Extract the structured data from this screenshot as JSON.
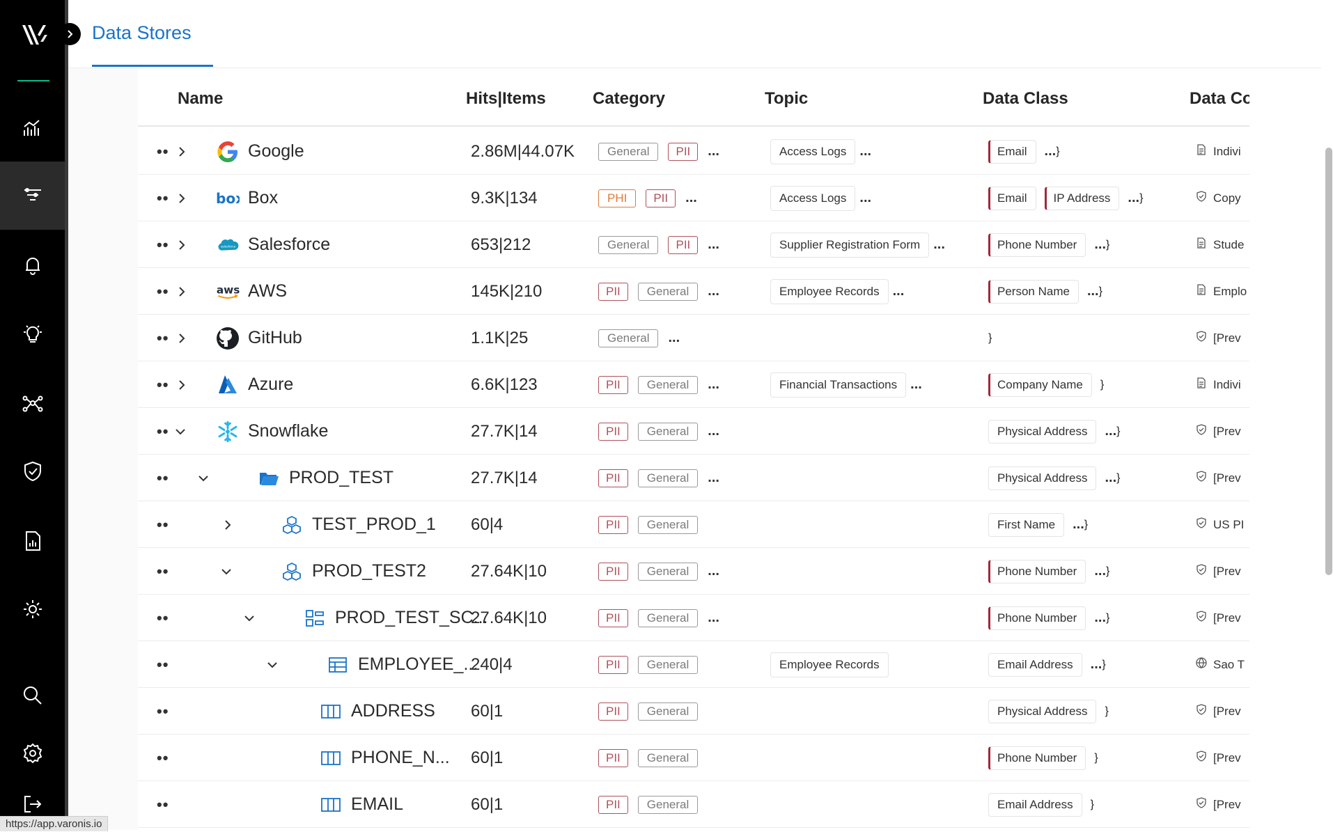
{
  "header": {
    "tab_label": "Data Stores"
  },
  "status_url": "https://app.varonis.io",
  "columns": {
    "name": "Name",
    "hits": "Hits|Items",
    "category": "Category",
    "topic": "Topic",
    "data_class": "Data Class",
    "data_co": "Data Co"
  },
  "rows": [
    {
      "name": "Google",
      "hits": "2.86M|44.07K",
      "tags": [
        "General",
        "PII"
      ],
      "more": "...",
      "topics": [
        "Access Logs"
      ],
      "topic_more": "...",
      "classes": [
        "Email"
      ],
      "class_more": "...",
      "dco": "Indivi",
      "icon": "google-logo",
      "dco_icon": "document-icon"
    },
    {
      "name": "Box",
      "hits": "9.3K|134",
      "tags": [
        "PHI",
        "PII"
      ],
      "more": "...",
      "topics": [
        "Access Logs"
      ],
      "topic_more": "...",
      "classes": [
        "Email",
        "IP Address"
      ],
      "class_more": "...",
      "dco": "Copy",
      "icon": "box-logo",
      "dco_icon": "shield-icon"
    },
    {
      "name": "Salesforce",
      "hits": "653|212",
      "tags": [
        "General",
        "PII"
      ],
      "more": "...",
      "topics": [
        "Supplier Registration Form"
      ],
      "topic_more": "...",
      "classes": [
        "Phone Number"
      ],
      "class_more": "...",
      "dco": "Stude",
      "icon": "salesforce-logo",
      "dco_icon": "document-icon"
    },
    {
      "name": "AWS",
      "hits": "145K|210",
      "tags": [
        "PII",
        "General"
      ],
      "more": "...",
      "topics": [
        "Employee Records"
      ],
      "topic_more": "...",
      "classes": [
        "Person Name"
      ],
      "class_more": "...",
      "dco": "Emplo",
      "icon": "aws-logo",
      "dco_icon": "document-icon"
    },
    {
      "name": "GitHub",
      "hits": "1.1K|25",
      "tags": [
        "General"
      ],
      "more": "...",
      "topics": [],
      "topic_more": "",
      "classes": [],
      "class_more": "",
      "dco": "[Prev",
      "icon": "github-logo",
      "dco_icon": "shield-icon"
    },
    {
      "name": "Azure",
      "hits": "6.6K|123",
      "tags": [
        "PII",
        "General"
      ],
      "more": "...",
      "topics": [
        "Financial Transactions"
      ],
      "topic_more": "...",
      "classes": [
        "Company Name"
      ],
      "class_more": "",
      "dco": "Indivi",
      "icon": "azure-logo",
      "dco_icon": "document-icon"
    },
    {
      "name": "Snowflake",
      "hits": "27.7K|14",
      "tags": [
        "PII",
        "General"
      ],
      "more": "...",
      "topics": [],
      "topic_more": "",
      "classes": [
        "Physical Address"
      ],
      "class_more": "...",
      "dco": "[Prev",
      "icon": "snowflake-logo",
      "dco_icon": "shield-icon"
    },
    {
      "name": "PROD_TEST",
      "hits": "27.7K|14",
      "tags": [
        "PII",
        "General"
      ],
      "more": "...",
      "topics": [],
      "topic_more": "",
      "classes": [
        "Physical Address"
      ],
      "class_more": "...",
      "dco": "[Prev",
      "icon": "folder-icon",
      "dco_icon": "shield-icon"
    },
    {
      "name": "TEST_PROD_1",
      "hits": "60|4",
      "tags": [
        "PII",
        "General"
      ],
      "more": "",
      "topics": [],
      "topic_more": "",
      "classes": [
        "First Name"
      ],
      "class_more": "...",
      "dco": "US PI",
      "icon": "cubes-icon",
      "dco_icon": "shield-icon"
    },
    {
      "name": "PROD_TEST2",
      "hits": "27.64K|10",
      "tags": [
        "PII",
        "General"
      ],
      "more": "...",
      "topics": [],
      "topic_more": "",
      "classes": [
        "Phone Number"
      ],
      "class_more": "...",
      "dco": "[Prev",
      "icon": "cubes-icon",
      "dco_icon": "shield-icon"
    },
    {
      "name": "PROD_TEST_SC...",
      "hits": "27.64K|10",
      "tags": [
        "PII",
        "General"
      ],
      "more": "...",
      "topics": [],
      "topic_more": "",
      "classes": [
        "Phone Number"
      ],
      "class_more": "...",
      "dco": "[Prev",
      "icon": "schema-icon",
      "dco_icon": "shield-icon"
    },
    {
      "name": "EMPLOYEE_...",
      "hits": "240|4",
      "tags": [
        "PII",
        "General"
      ],
      "more": "",
      "topics": [
        "Employee Records"
      ],
      "topic_more": "",
      "classes": [
        "Email Address"
      ],
      "class_more": "...",
      "dco": "Sao T",
      "icon": "table-icon",
      "dco_icon": "globe-icon"
    },
    {
      "name": "ADDRESS",
      "hits": "60|1",
      "tags": [
        "PII",
        "General"
      ],
      "more": "",
      "topics": [],
      "topic_more": "",
      "classes": [
        "Physical Address"
      ],
      "class_more": "",
      "dco": "[Prev",
      "icon": "column-icon",
      "dco_icon": "shield-icon"
    },
    {
      "name": "PHONE_N...",
      "hits": "60|1",
      "tags": [
        "PII",
        "General"
      ],
      "more": "",
      "topics": [],
      "topic_more": "",
      "classes": [
        "Phone Number"
      ],
      "class_more": "",
      "dco": "[Prev",
      "icon": "column-icon",
      "dco_icon": "shield-icon"
    },
    {
      "name": "EMAIL",
      "hits": "60|1",
      "tags": [
        "PII",
        "General"
      ],
      "more": "",
      "topics": [],
      "topic_more": "",
      "classes": [
        "Email Address"
      ],
      "class_more": "",
      "dco": "[Prev",
      "icon": "column-icon",
      "dco_icon": "shield-icon"
    }
  ],
  "row_menu": "••",
  "nav_items": [
    "dashboard-icon",
    "filters-icon",
    "bell-icon",
    "lightbulb-icon",
    "graph-icon",
    "shield-check-icon",
    "report-icon",
    "sun-icon",
    "search-icon",
    "settings-icon",
    "logout-icon"
  ],
  "colors": {
    "accent": "#1a73c8",
    "pii": "#b0505a",
    "phi": "#e07a3a",
    "nav_bg": "#000000",
    "divider": "#12b886"
  }
}
